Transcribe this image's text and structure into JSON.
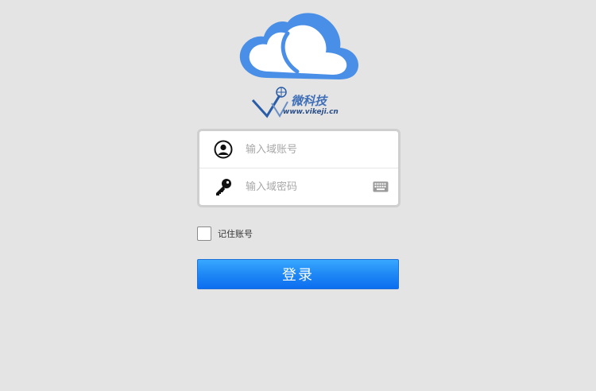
{
  "logo": {
    "icon": "cloud-icon",
    "accent_color": "#4a8fe7"
  },
  "watermark": {
    "brand": "微科技",
    "url": "www.vikeji.cn"
  },
  "form": {
    "account": {
      "icon": "user-icon",
      "placeholder": "输入域账号",
      "value": ""
    },
    "password": {
      "icon": "key-icon",
      "placeholder": "输入域密码",
      "value": "",
      "trailing_icon": "keyboard-icon"
    }
  },
  "remember": {
    "label": "记住账号",
    "checked": false
  },
  "login_button": {
    "label": "登录",
    "color": "#1f88f5"
  }
}
